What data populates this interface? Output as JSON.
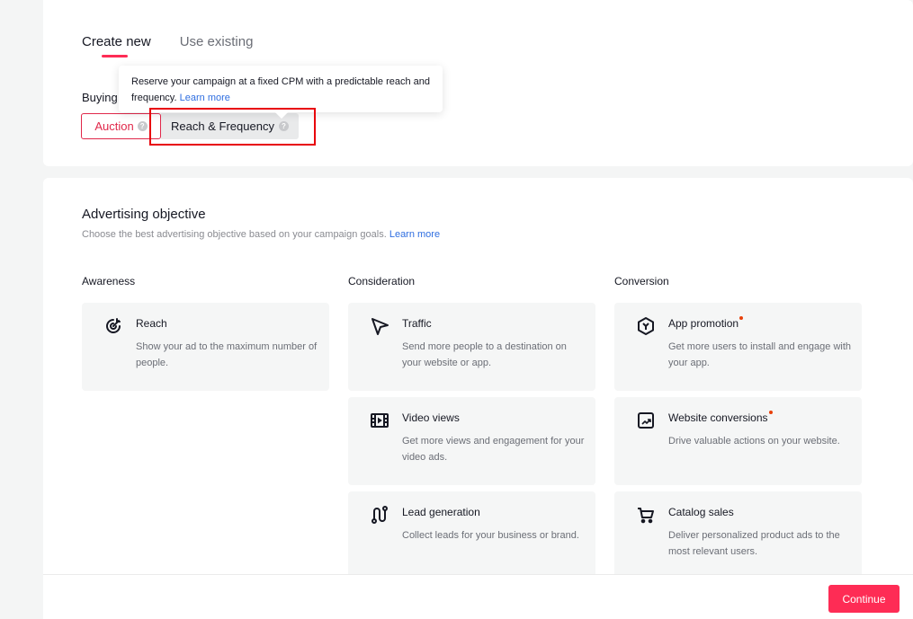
{
  "tabs": [
    {
      "label": "Create new",
      "active": true
    },
    {
      "label": "Use existing",
      "active": false
    }
  ],
  "buying_type": {
    "label": "Buying type",
    "label_visible": "Buying",
    "options": [
      {
        "label": "Auction",
        "icon": "help-icon"
      },
      {
        "label": "Reach & Frequency",
        "icon": "help-icon"
      }
    ],
    "tooltip": {
      "text": "Reserve your campaign at a fixed CPM with a predictable reach and frequency.",
      "link": "Learn more"
    }
  },
  "objective": {
    "title": "Advertising objective",
    "subtitle": "Choose the best advertising objective based on your campaign goals.",
    "subtitle_link": "Learn more",
    "columns": [
      {
        "heading": "Awareness",
        "cards": [
          {
            "icon": "reach-target-icon",
            "title": "Reach",
            "desc": "Show your ad to the maximum number of people.",
            "new": false
          }
        ]
      },
      {
        "heading": "Consideration",
        "cards": [
          {
            "icon": "cursor-arrow-icon",
            "title": "Traffic",
            "desc": "Send more people to a destination on your website or app.",
            "new": false
          },
          {
            "icon": "video-film-icon",
            "title": "Video views",
            "desc": "Get more views and engagement for your video ads.",
            "new": false
          },
          {
            "icon": "lead-path-icon",
            "title": "Lead generation",
            "desc": "Collect leads for your business or brand.",
            "new": false
          }
        ]
      },
      {
        "heading": "Conversion",
        "cards": [
          {
            "icon": "app-hexagon-icon",
            "title": "App promotion",
            "desc": "Get more users to install and engage with your app.",
            "new": true
          },
          {
            "icon": "trend-chart-icon",
            "title": "Website conversions",
            "desc": "Drive valuable actions on your website.",
            "new": true
          },
          {
            "icon": "shopping-cart-icon",
            "title": "Catalog sales",
            "desc": "Deliver personalized product ads to the most relevant users.",
            "new": false
          }
        ]
      }
    ]
  },
  "footer": {
    "continue_label": "Continue"
  },
  "colors": {
    "accent": "#fe2c55",
    "link": "#2f6ee0",
    "new_dot": "#e8400b",
    "highlight": "#e8000b"
  }
}
